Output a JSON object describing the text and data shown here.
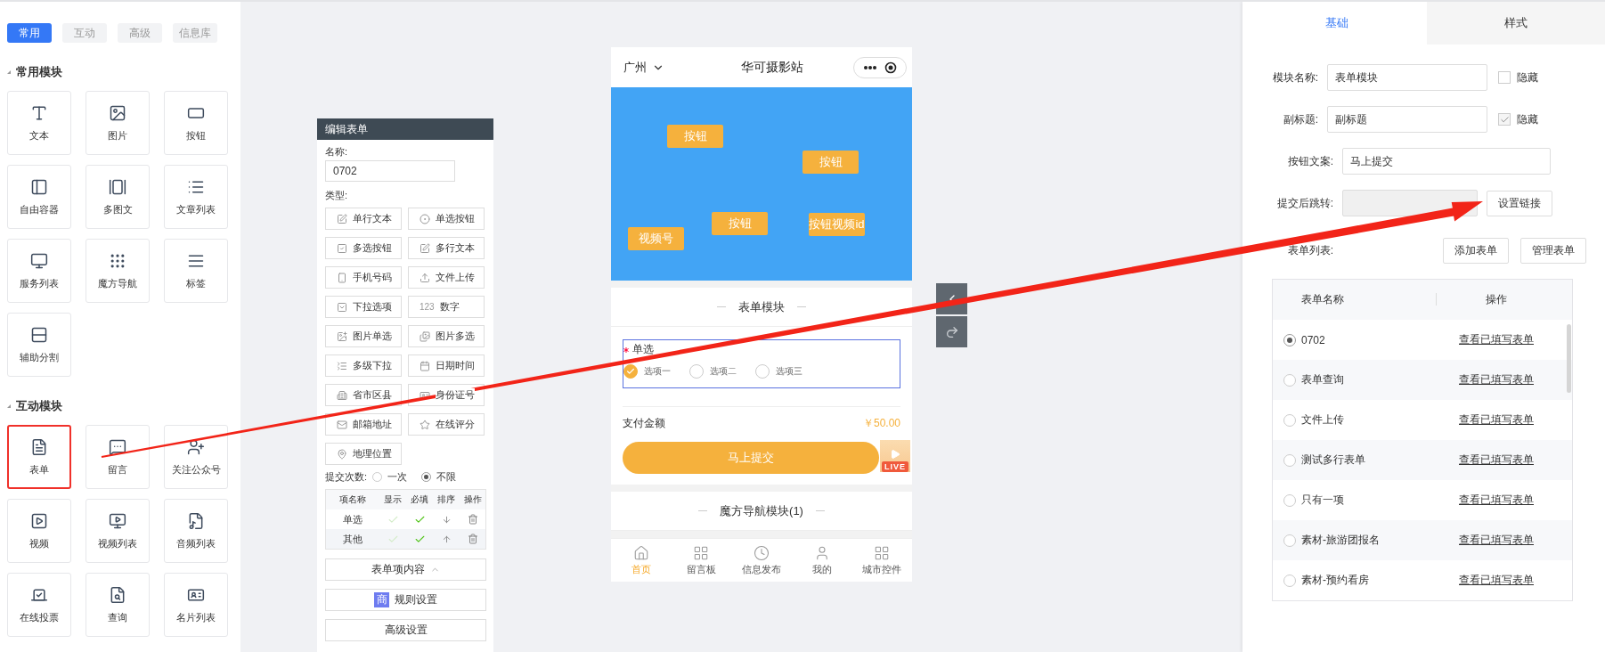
{
  "left_panel": {
    "tabs": [
      {
        "label": "常用",
        "selected": true
      },
      {
        "label": "互动",
        "selected": false
      },
      {
        "label": "高级",
        "selected": false
      },
      {
        "label": "信息库",
        "selected": false
      }
    ],
    "groups": [
      {
        "title": "常用模块",
        "items": [
          {
            "label": "文本",
            "highlighted": false
          },
          {
            "label": "图片",
            "highlighted": false
          },
          {
            "label": "按钮",
            "highlighted": false
          },
          {
            "label": "自由容器",
            "highlighted": false
          },
          {
            "label": "多图文",
            "highlighted": false
          },
          {
            "label": "文章列表",
            "highlighted": false
          },
          {
            "label": "服务列表",
            "highlighted": false
          },
          {
            "label": "魔方导航",
            "highlighted": false
          },
          {
            "label": "标签",
            "highlighted": false
          },
          {
            "label": "辅助分割",
            "highlighted": false
          }
        ]
      },
      {
        "title": "互动模块",
        "items": [
          {
            "label": "表单",
            "highlighted": true
          },
          {
            "label": "留言",
            "highlighted": false
          },
          {
            "label": "关注公众号",
            "highlighted": false
          },
          {
            "label": "视频",
            "highlighted": false
          },
          {
            "label": "视频列表",
            "highlighted": false
          },
          {
            "label": "音频列表",
            "highlighted": false
          },
          {
            "label": "在线投票",
            "highlighted": false
          },
          {
            "label": "查询",
            "highlighted": false
          },
          {
            "label": "名片列表",
            "highlighted": false
          }
        ]
      }
    ]
  },
  "editor": {
    "title": "编辑表单",
    "name_label": "名称:",
    "name_value": "0702",
    "type_label": "类型:",
    "types": [
      {
        "label": "单行文本"
      },
      {
        "label": "单选按钮"
      },
      {
        "label": "多选按钮"
      },
      {
        "label": "多行文本"
      },
      {
        "label": "手机号码"
      },
      {
        "label": "文件上传"
      },
      {
        "label": "下拉选项"
      },
      {
        "label": "数字",
        "glyph": "123"
      },
      {
        "label": "图片单选"
      },
      {
        "label": "图片多选"
      },
      {
        "label": "多级下拉"
      },
      {
        "label": "日期时间"
      },
      {
        "label": "省市区县"
      },
      {
        "label": "身份证号"
      },
      {
        "label": "邮箱地址"
      },
      {
        "label": "在线评分"
      },
      {
        "label": "地理位置"
      }
    ],
    "submit_count": {
      "label": "提交次数:",
      "options": [
        {
          "label": "一次",
          "selected": false
        },
        {
          "label": "不限",
          "selected": true
        }
      ]
    },
    "table": {
      "columns": [
        "项名称",
        "显示",
        "必填",
        "排序",
        "操作"
      ],
      "rows": [
        {
          "name": "单选",
          "show": false,
          "required": true,
          "moves_up": false
        },
        {
          "name": "其他",
          "show": false,
          "required": true,
          "moves_up": true
        }
      ]
    },
    "buttons": [
      {
        "label": "表单项内容",
        "kind": "expand"
      },
      {
        "label": "规则设置",
        "kind": "badge",
        "badge": "商"
      },
      {
        "label": "高级设置",
        "kind": "plain"
      }
    ]
  },
  "phone": {
    "location": "广州",
    "title": "华可摄影站",
    "banner_buttons": [
      "按钮",
      "按钮",
      "按钮",
      "视频号",
      "按钮视频id"
    ],
    "form_section": {
      "title": "表单模块",
      "field": {
        "label": "单选",
        "required": true,
        "options": [
          {
            "label": "选项一",
            "selected": true
          },
          {
            "label": "选项二",
            "selected": false
          },
          {
            "label": "选项三",
            "selected": false
          }
        ]
      },
      "pay_label": "支付金额",
      "pay_amount": "￥50.00",
      "submit": "马上提交",
      "live": "LIVE"
    },
    "nav_section": {
      "title": "魔方导航模块(1)"
    },
    "tabbar": [
      {
        "label": "首页",
        "selected": true
      },
      {
        "label": "留言板",
        "selected": false
      },
      {
        "label": "信息发布",
        "selected": false
      },
      {
        "label": "我的",
        "selected": false
      },
      {
        "label": "城市控件",
        "selected": false
      }
    ]
  },
  "right_panel": {
    "tabs": [
      {
        "label": "基础",
        "selected": true
      },
      {
        "label": "样式",
        "selected": false
      }
    ],
    "fields": [
      {
        "kind": "text",
        "label": "模块名称:",
        "value": "表单模块",
        "hide_label": "隐藏",
        "hidden": false
      },
      {
        "kind": "text",
        "label": "副标题:",
        "value": "副标题",
        "hide_label": "隐藏",
        "hidden": true
      },
      {
        "kind": "wide",
        "label": "按钮文案:",
        "value": "马上提交"
      },
      {
        "kind": "link",
        "label": "提交后跳转:",
        "button": "设置链接"
      },
      {
        "kind": "buttons",
        "label": "表单列表:",
        "buttons": [
          "添加表单",
          "管理表单"
        ]
      }
    ],
    "table": {
      "columns": [
        "表单名称",
        "操作"
      ],
      "rows": [
        {
          "name": "0702",
          "selected": true,
          "action": "查看已填写表单"
        },
        {
          "name": "表单查询",
          "selected": false,
          "action": "查看已填写表单"
        },
        {
          "name": "文件上传",
          "selected": false,
          "action": "查看已填写表单"
        },
        {
          "name": "测试多行表单",
          "selected": false,
          "action": "查看已填写表单"
        },
        {
          "name": "只有一项",
          "selected": false,
          "action": "查看已填写表单"
        },
        {
          "name": "素材-旅游团报名",
          "selected": false,
          "action": "查看已填写表单"
        },
        {
          "name": "素材-预约看房",
          "selected": false,
          "action": "查看已填写表单"
        }
      ]
    }
  }
}
